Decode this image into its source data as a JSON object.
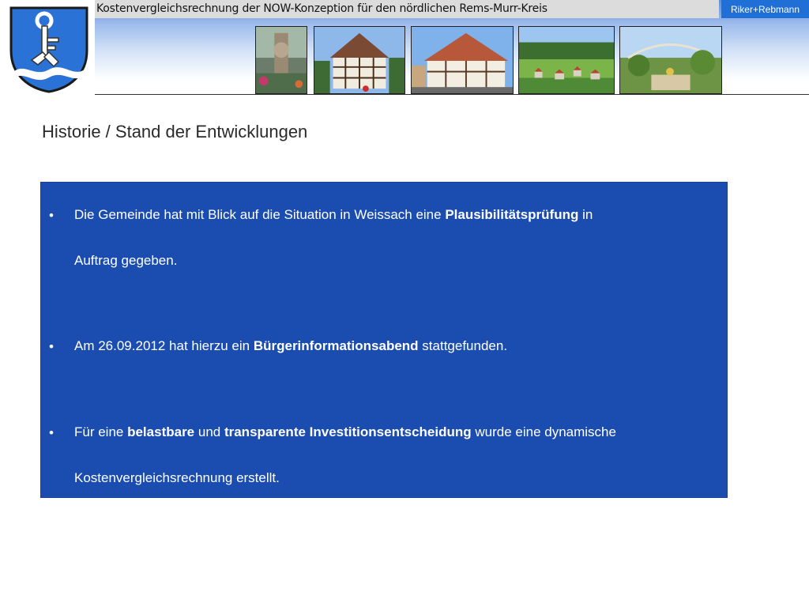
{
  "header": {
    "title": "Kostenvergleichsrechnung der NOW-Konzeption für den nördlichen Rems-Murr-Kreis",
    "company": "Riker+Rebmann"
  },
  "crest": {
    "icon": "key-crest-icon",
    "colors": {
      "field": "#2b72d6",
      "key": "#ffffff",
      "outline": "#1a1a1a"
    }
  },
  "photos": [
    "fountain-photo",
    "half-timbered-house-photo",
    "town-hall-photo",
    "village-landscape-photo",
    "garden-photo"
  ],
  "section": {
    "heading": "Historie / Stand der Entwicklungen"
  },
  "bullets": [
    {
      "line1": {
        "pre": "Die Gemeinde hat mit Blick auf die Situation in Weissach eine ",
        "bold": "Plausibilitätsprüfung",
        "post": " in"
      },
      "line2": "Auftrag gegeben."
    },
    {
      "line1": {
        "pre": "Am 26.09.2012 hat hierzu ein ",
        "bold": "Bürgerinformationsabend",
        "post": " stattgefunden."
      }
    },
    {
      "line1": {
        "pre": "Für eine ",
        "bold1": "belastbare",
        "mid": " und ",
        "bold2": "transparente Investitionsentscheidung",
        "post": " wurde eine dynamische"
      },
      "line2": "Kostenvergleichsrechnung erstellt."
    }
  ],
  "colors": {
    "panel": "#1b4db0",
    "badge": "#1f6fd6",
    "panel_text": "#ffffff"
  }
}
